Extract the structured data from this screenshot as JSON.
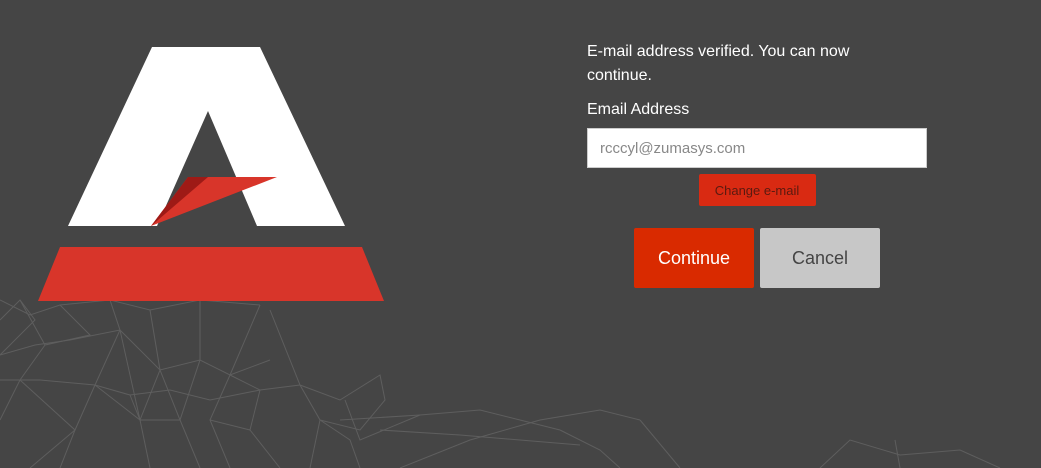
{
  "verification": {
    "message": "E-mail address verified. You can now continue."
  },
  "email": {
    "label": "Email Address",
    "value": "rcccyl@zumasys.com"
  },
  "actions": {
    "change_email": "Change e-mail",
    "continue": "Continue",
    "cancel": "Cancel"
  },
  "colors": {
    "background": "#454545",
    "accent": "#d92a00",
    "logo_white": "#ffffff",
    "logo_red": "#d8352a",
    "cancel_bg": "#c7c7c7"
  }
}
